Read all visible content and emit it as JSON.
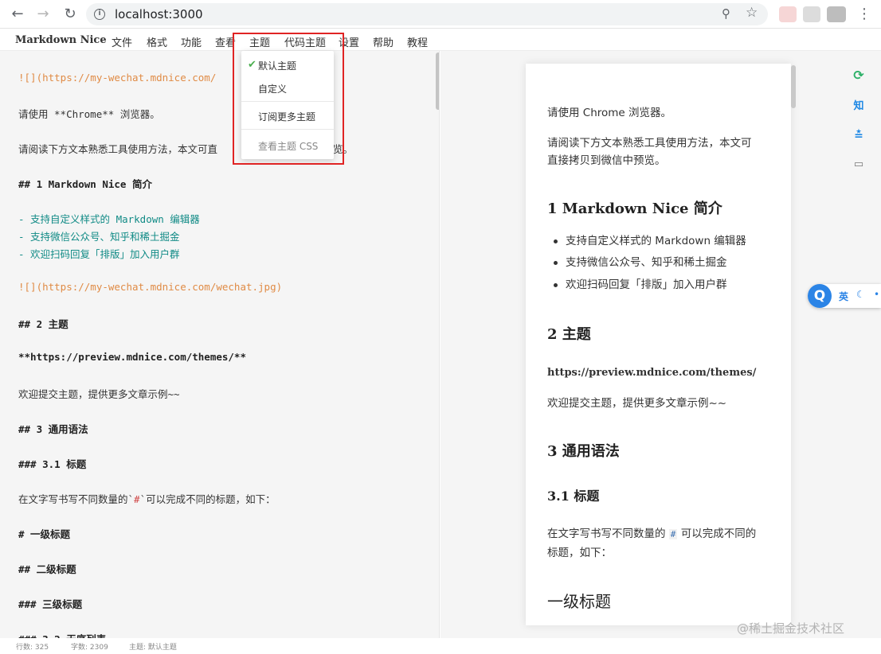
{
  "browser": {
    "url": "localhost:3000",
    "back_icon": "arrow-left",
    "forward_icon": "arrow-right",
    "reload_icon": "reload"
  },
  "app": {
    "brand": "Markdown Nice",
    "menu": [
      "文件",
      "格式",
      "功能",
      "查看",
      "主题",
      "代码主题",
      "设置",
      "帮助",
      "教程"
    ]
  },
  "theme_menu": {
    "items": [
      "默认主题",
      "自定义",
      "订阅更多主题",
      "查看主题 CSS"
    ],
    "selected": "默认主题"
  },
  "editor": {
    "lines": [
      "![](https://my-wechat.mdnice.com/",
      "请使用 **Chrome** 浏览器。",
      "请阅读下方文本熟悉工具使用方法，本文可直",
      "## 1 Markdown Nice 简介",
      "- 支持自定义样式的 Markdown 编辑器",
      "- 支持微信公众号、知乎和稀土掘金",
      "- 欢迎扫码回复「排版」加入用户群",
      "![](https://my-wechat.mdnice.com/wechat.jpg)",
      "## 2 主题",
      "**https://preview.mdnice.com/themes/**",
      "欢迎提交主题，提供更多文章示例~~",
      "## 3 通用语法",
      "### 3.1 标题",
      "在文字写书写不同数量的`",
      "`可以完成不同的标题，如下：",
      "# 一级标题",
      "## 二级标题",
      "### 三级标题",
      "### 3.2 无序列表"
    ],
    "inline_hash": "#",
    "tail_fragment": "览。"
  },
  "preview": {
    "p1": "请使用 Chrome 浏览器。",
    "p2_line1": "请阅读下方文本熟悉工具使用方法，本文可",
    "p2_line2": "直接拷贝到微信中预览。",
    "h_intro": "1 Markdown Nice 简介",
    "bullets": [
      "支持自定义样式的 Markdown 编辑器",
      "支持微信公众号、知乎和稀土掘金",
      "欢迎扫码回复「排版」加入用户群"
    ],
    "h_theme": "2 主题",
    "theme_link": "https://preview.mdnice.com/themes/",
    "theme_note": "欢迎提交主题，提供更多文章示例~~",
    "h_syntax": "3 通用语法",
    "h_title": "3.1 标题",
    "title_p_before": "在文字写书写不同数量的 ",
    "title_p_code": "#",
    "title_p_after": " 可以完成不同的",
    "title_p_line2": "标题，如下：",
    "h1_demo": "一级标题"
  },
  "rail": {
    "icons": [
      "wechat-icon",
      "zhihu-icon",
      "juejin-icon",
      "monitor-icon"
    ],
    "zhihu_label": "知"
  },
  "ime": {
    "logo": "Q",
    "lang": "英"
  },
  "status": {
    "lines": "行数: 325",
    "chars": "字数: 2309",
    "theme": "主题: 默认主题"
  },
  "watermark": "@稀土掘金技术社区"
}
